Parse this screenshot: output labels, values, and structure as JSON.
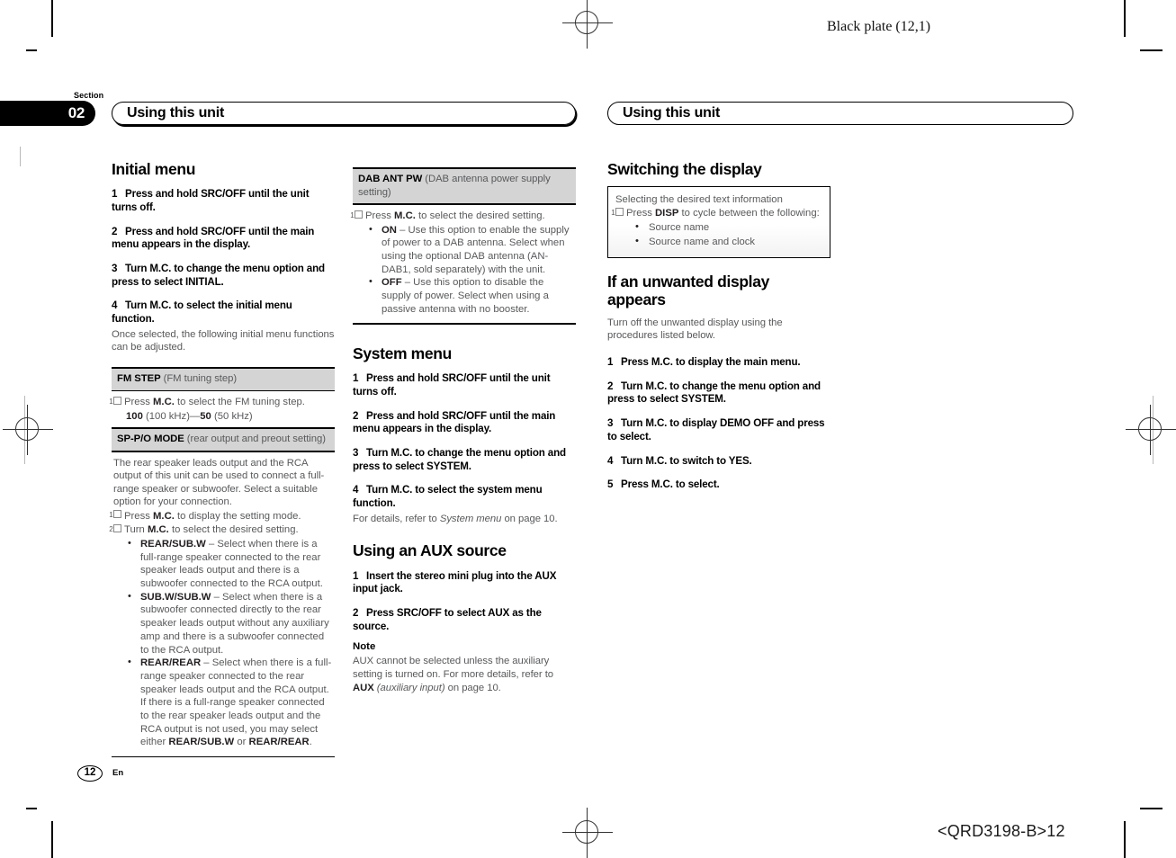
{
  "print_marks": {
    "plate_label": "Black plate (12,1)",
    "job_code": "<QRD3198-B>12"
  },
  "section": {
    "label": "Section",
    "number": "02"
  },
  "running_head": {
    "left": "Using this unit",
    "right": "Using this unit"
  },
  "folio": {
    "page_number": "12",
    "language": "En"
  },
  "column1": {
    "heading": "Initial menu",
    "steps": [
      {
        "n": "1",
        "text": "Press and hold SRC/OFF until the unit turns off."
      },
      {
        "n": "2",
        "text": "Press and hold SRC/OFF until the main menu appears in the display."
      },
      {
        "n": "3",
        "text": "Turn M.C. to change the menu option and press to select INITIAL."
      },
      {
        "n": "4",
        "text": "Turn M.C. to select the initial menu function."
      }
    ],
    "after_step4": "Once selected, the following initial menu functions can be adjusted.",
    "fm_step": {
      "title": "FM STEP",
      "subtitle": "(FM tuning step)",
      "marker": "1",
      "instruction_pre": "Press ",
      "instruction_key": "M.C.",
      "instruction_post": " to select the FM tuning step.",
      "values": "100 (100 kHz)—50 (50 kHz)",
      "value1_bold": "100",
      "value1_rest": " (100 kHz)—",
      "value2_bold": "50",
      "value2_rest": " (50 kHz)"
    },
    "sp_po_mode": {
      "title": "SP-P/O MODE",
      "subtitle": "(rear output and preout setting)",
      "intro": "The rear speaker leads output and the RCA output of this unit can be used to connect a full-range speaker or subwoofer. Select a suitable option for your connection.",
      "marker1": "1",
      "step1_pre": "Press ",
      "step1_key": "M.C.",
      "step1_post": " to display the setting mode.",
      "marker2": "2",
      "step2_pre": "Turn ",
      "step2_key": "M.C.",
      "step2_post": " to select the desired setting.",
      "options": [
        {
          "name": "REAR/SUB.W",
          "desc": " – Select when there is a full-range speaker connected to the rear speaker leads output and there is a subwoofer connected to the RCA output."
        },
        {
          "name": "SUB.W/SUB.W",
          "desc": " – Select when there is a subwoofer connected directly to the rear speaker leads output without any auxiliary amp and there is a subwoofer connected to the RCA output."
        },
        {
          "name": "REAR/REAR",
          "desc": " – Select when there is a full-range speaker connected to the rear speaker leads output and the RCA output."
        }
      ],
      "final_note_pre": "If there is a full-range speaker connected to the rear speaker leads output and the RCA output is not used, you may select either ",
      "final_note_b1": "REAR/SUB.W",
      "final_note_mid": " or ",
      "final_note_b2": "REAR/REAR",
      "final_note_end": "."
    }
  },
  "column2": {
    "dab_ant_pw": {
      "title": "DAB ANT PW",
      "subtitle": "(DAB antenna power supply setting)",
      "marker": "1",
      "instruction_pre": "Press ",
      "instruction_key": "M.C.",
      "instruction_post": " to select the desired setting.",
      "options": [
        {
          "name": "ON",
          "desc": " – Use this option to enable the supply of power to a DAB antenna. Select when using the optional DAB antenna (AN-DAB1, sold separately) with the unit."
        },
        {
          "name": "OFF",
          "desc": " – Use this option to disable the supply of power. Select when using a passive antenna with no booster."
        }
      ]
    },
    "system_menu": {
      "heading": "System menu",
      "steps": [
        {
          "n": "1",
          "text": "Press and hold SRC/OFF until the unit turns off."
        },
        {
          "n": "2",
          "text": "Press and hold SRC/OFF until the main menu appears in the display."
        },
        {
          "n": "3",
          "text": "Turn M.C. to change the menu option and press to select SYSTEM."
        },
        {
          "n": "4",
          "text": "Turn M.C. to select the system menu function."
        }
      ],
      "detail_pre": "For details, refer to ",
      "detail_italic": "System menu",
      "detail_post": " on page 10."
    },
    "aux_source": {
      "heading": "Using an AUX source",
      "steps": [
        {
          "n": "1",
          "text": "Insert the stereo mini plug into the AUX input jack."
        },
        {
          "n": "2",
          "text": "Press SRC/OFF to select AUX as the source."
        }
      ],
      "note_heading": "Note",
      "note_pre": "AUX cannot be selected unless the auxiliary setting is turned on. For more details, refer to ",
      "note_bold": "AUX",
      "note_italic": " (auxiliary input)",
      "note_post": " on page 10."
    }
  },
  "column3": {
    "switching_display": {
      "heading": "Switching the display",
      "box_intro": "Selecting the desired text information",
      "marker": "1",
      "instruction_pre": "Press ",
      "instruction_key": "DISP",
      "instruction_post": " to cycle between the following:",
      "items": [
        "Source name",
        "Source name and clock"
      ]
    },
    "unwanted_display": {
      "heading": "If an unwanted display appears",
      "intro": "Turn off the unwanted display using the procedures listed below.",
      "steps": [
        {
          "n": "1",
          "text": "Press M.C. to display the main menu."
        },
        {
          "n": "2",
          "text": "Turn M.C. to change the menu option and press to select SYSTEM."
        },
        {
          "n": "3",
          "text": "Turn M.C. to display DEMO OFF and press to select."
        },
        {
          "n": "4",
          "text": "Turn M.C. to switch to YES."
        },
        {
          "n": "5",
          "text": "Press M.C. to select."
        }
      ]
    }
  }
}
